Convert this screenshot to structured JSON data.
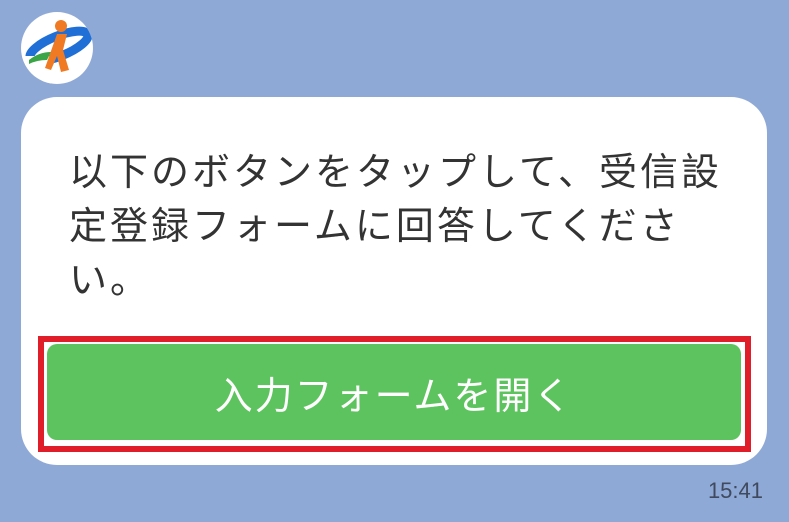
{
  "chat": {
    "sender_avatar_icon": "brand-logo-icon",
    "message_text": "以下のボタンをタップして、受信設定登録フォームに回答してください。",
    "button_label": "入力フォームを開く",
    "timestamp": "15:41"
  },
  "colors": {
    "background": "#8fa9d6",
    "bubble": "#ffffff",
    "button": "#5dc35e",
    "highlight_frame": "#e01e2a",
    "logo_blue": "#1f6fd6",
    "logo_orange": "#f07a23",
    "logo_green": "#3aa546"
  }
}
